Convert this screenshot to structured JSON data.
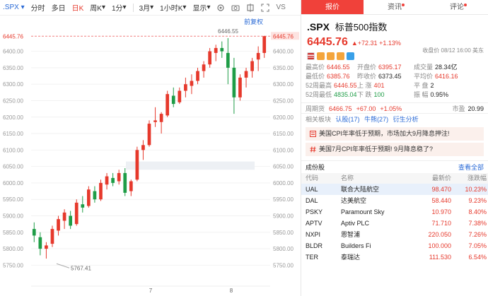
{
  "toolbar": {
    "symbol": ".SPX",
    "items": [
      "分时",
      "多日",
      "日K",
      "周K",
      "1分",
      "3月",
      "1小时K",
      "显示"
    ],
    "active_index": 2,
    "vs": "VS"
  },
  "chart": {
    "pre_restore": "前复权",
    "price_line_label": "6445.76",
    "high_label": "6446.55",
    "low_label": "5767.41",
    "y_ticks": [
      "6400.00",
      "6350.00",
      "6300.00",
      "6250.00",
      "6200.00",
      "6150.00",
      "6100.00",
      "6050.00",
      "6000.00",
      "5950.00",
      "5900.00",
      "5850.00",
      "5800.00",
      "5750.00"
    ],
    "left_ticks": [
      "6445.76",
      "6400.00",
      "6350.00",
      "6300.00",
      "6250.00",
      "6200.00",
      "6150.00",
      "6100.00",
      "6050.00",
      "6000.00",
      "5950.00",
      "5900.00",
      "5850.00",
      "5800.00",
      "5750.00"
    ],
    "x_labels": [
      "7",
      "8"
    ],
    "colors": {
      "up": "#e6392c",
      "down": "#1f9d47",
      "line": "#f08080"
    }
  },
  "chart_data": {
    "type": "candlestick",
    "title": "",
    "ylim": [
      5710,
      6470
    ],
    "candles": [
      [
        5860,
        5880,
        5820,
        5840
      ],
      [
        5835,
        5850,
        5780,
        5800
      ],
      [
        5800,
        5820,
        5770,
        5810
      ],
      [
        5815,
        5870,
        5805,
        5860
      ],
      [
        5855,
        5900,
        5840,
        5890
      ],
      [
        5885,
        5920,
        5860,
        5910
      ],
      [
        5900,
        5915,
        5860,
        5870
      ],
      [
        5875,
        5950,
        5870,
        5940
      ],
      [
        5935,
        5960,
        5910,
        5925
      ],
      [
        5930,
        5990,
        5925,
        5980
      ],
      [
        5975,
        5990,
        5940,
        5950
      ],
      [
        5950,
        6010,
        5945,
        6000
      ],
      [
        5995,
        6030,
        5980,
        6020
      ],
      [
        6015,
        6030,
        5990,
        6000
      ],
      [
        6005,
        6040,
        5995,
        6030
      ],
      [
        6030,
        6045,
        5960,
        5970
      ],
      [
        5975,
        6010,
        5960,
        6005
      ],
      [
        6010,
        6110,
        6005,
        6100
      ],
      [
        6100,
        6130,
        6070,
        6115
      ],
      [
        6115,
        6190,
        6110,
        6180
      ],
      [
        6185,
        6230,
        6170,
        6190
      ],
      [
        6185,
        6215,
        6150,
        6210
      ],
      [
        6205,
        6280,
        6200,
        6270
      ],
      [
        6265,
        6290,
        6230,
        6240
      ],
      [
        6245,
        6290,
        6240,
        6280
      ],
      [
        6280,
        6320,
        6260,
        6300
      ],
      [
        6295,
        6330,
        6270,
        6310
      ],
      [
        6310,
        6350,
        6300,
        6340
      ],
      [
        6340,
        6370,
        6320,
        6360
      ],
      [
        6360,
        6410,
        6350,
        6400
      ],
      [
        6395,
        6420,
        6370,
        6410
      ],
      [
        6410,
        6430,
        6380,
        6400
      ],
      [
        6395,
        6440,
        6300,
        6350
      ],
      [
        6350,
        6380,
        6210,
        6260
      ],
      [
        6260,
        6330,
        6250,
        6320
      ],
      [
        6320,
        6350,
        6290,
        6340
      ],
      [
        6340,
        6380,
        6320,
        6370
      ],
      [
        6375,
        6415,
        6340,
        6395
      ],
      [
        6395,
        6447,
        6380,
        6446
      ]
    ]
  },
  "quote": {
    "tabs": [
      "报价",
      "资讯",
      "评论"
    ],
    "symbol": ".SPX",
    "name": "标普500指数",
    "price": "6445.76",
    "change": "+72.31",
    "change_pct": "+1.13%",
    "timestamp": "收盘价 08/12 16:00 美东",
    "stats": [
      [
        [
          "最高价",
          "6446.55",
          "red"
        ],
        [
          "开盘价",
          "6395.17",
          "red"
        ],
        [
          "成交量",
          "28.34亿",
          "dark"
        ]
      ],
      [
        [
          "最低价",
          "6385.76",
          "red"
        ],
        [
          "昨收价",
          "6373.45",
          "dark"
        ],
        [
          "平均价",
          "6416.16",
          "red"
        ]
      ],
      [
        [
          "52周最高",
          "6446.55",
          "red"
        ],
        [
          "上 涨",
          "401",
          "red"
        ],
        [
          "平 盘",
          "2",
          "dark"
        ]
      ],
      [
        [
          "52周最低",
          "4835.04",
          "green"
        ],
        [
          "下 跌",
          "100",
          "green"
        ],
        [
          "振 幅",
          "0.95%",
          "dark"
        ]
      ]
    ],
    "after_hours": {
      "label": "周期货",
      "price": "6466.75",
      "change": "+67.00",
      "pct": "+1.05%",
      "pe_label": "市盈",
      "pe": "20.99"
    },
    "related": {
      "label": "相关板块",
      "tags": [
        "认股(17)",
        "牛熊(27)",
        "衍生分析"
      ]
    },
    "news": [
      "美国CPI年率低于预期，市场加大9月降息押注!",
      "美国7月CPI年率低于预期! 9月降息稳了?"
    ],
    "constituents": {
      "title": "成份股",
      "more": "查看全部",
      "columns": [
        "代码",
        "名称",
        "最新价",
        "涨跌幅"
      ],
      "rows": [
        [
          "UAL",
          "联合大陆航空",
          "98.470",
          "10.23%"
        ],
        [
          "DAL",
          "达美航空",
          "58.440",
          "9.23%"
        ],
        [
          "PSKY",
          "Paramount Sky",
          "10.970",
          "8.40%"
        ],
        [
          "APTV",
          "Aptiv PLC",
          "71.710",
          "7.38%"
        ],
        [
          "NXPI",
          "恩智浦",
          "220.050",
          "7.26%"
        ],
        [
          "BLDR",
          "Builders Fi",
          "100.000",
          "7.05%"
        ],
        [
          "TER",
          "泰瑞达",
          "111.530",
          "6.54%"
        ]
      ]
    }
  }
}
